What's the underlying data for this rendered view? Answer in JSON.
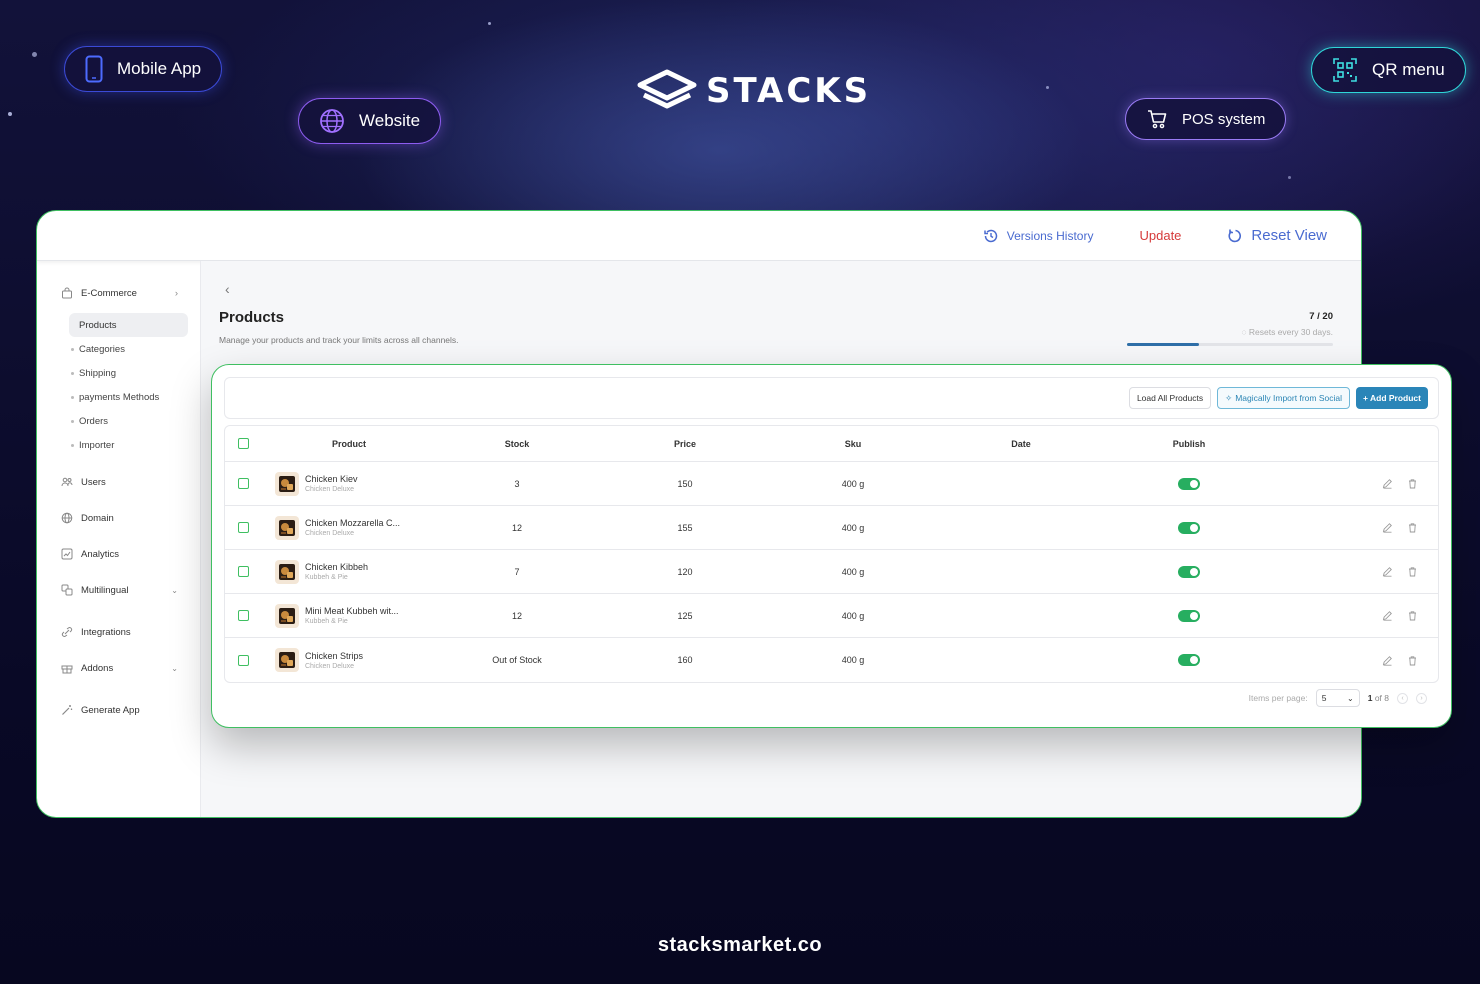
{
  "hero": {
    "brand": "STACKS",
    "pills": {
      "mobile": "Mobile App",
      "website": "Website",
      "pos": "POS system",
      "qr": "QR menu"
    },
    "footer_url": "stacksmarket.co"
  },
  "topbar": {
    "versions": "Versions History",
    "update": "Update",
    "reset": "Reset View"
  },
  "sidebar": {
    "ecommerce": "E-Commerce",
    "sub_items": [
      "Products",
      "Categories",
      "Shipping",
      "payments Methods",
      "Orders",
      "Importer"
    ],
    "main_items": [
      "Users",
      "Domain",
      "Analytics",
      "Multilingual",
      "Integrations",
      "Addons",
      "Generate App"
    ]
  },
  "page": {
    "back": "‹",
    "title": "Products",
    "subtitle": "Manage your products and track your limits across all channels.",
    "limit_count": "7 / 20",
    "limit_note": "Resets every 30 days.",
    "limit_fraction": 0.35
  },
  "actions": {
    "load_all": "Load All Products",
    "magic_import": "Magically Import from Social",
    "add_product": "+ Add Product"
  },
  "table": {
    "headers": [
      "Product",
      "Stock",
      "Price",
      "Sku",
      "Date",
      "Publish"
    ],
    "rows": [
      {
        "name": "Chicken Kiev",
        "category": "Chicken Deluxe",
        "stock": "3",
        "price": "150",
        "sku": "400 g",
        "date": "",
        "published": true
      },
      {
        "name": "Chicken Mozzarella C...",
        "category": "Chicken Deluxe",
        "stock": "12",
        "price": "155",
        "sku": "400 g",
        "date": "",
        "published": true
      },
      {
        "name": "Chicken Kibbeh",
        "category": "Kubbeh & Pie",
        "stock": "7",
        "price": "120",
        "sku": "400 g",
        "date": "",
        "published": true
      },
      {
        "name": "Mini Meat Kubbeh wit...",
        "category": "Kubbeh & Pie",
        "stock": "12",
        "price": "125",
        "sku": "400 g",
        "date": "",
        "published": true
      },
      {
        "name": "Chicken Strips",
        "category": "Chicken Deluxe",
        "stock": "Out of Stock",
        "price": "160",
        "sku": "400 g",
        "date": "",
        "published": true
      }
    ]
  },
  "pagination": {
    "items_label": "Items per page:",
    "per_page": "5",
    "current": "1",
    "of_text": "of 8"
  },
  "colors": {
    "accent_green": "#3fbf61",
    "primary_blue": "#2a85b8",
    "update_red": "#d63a3a"
  }
}
